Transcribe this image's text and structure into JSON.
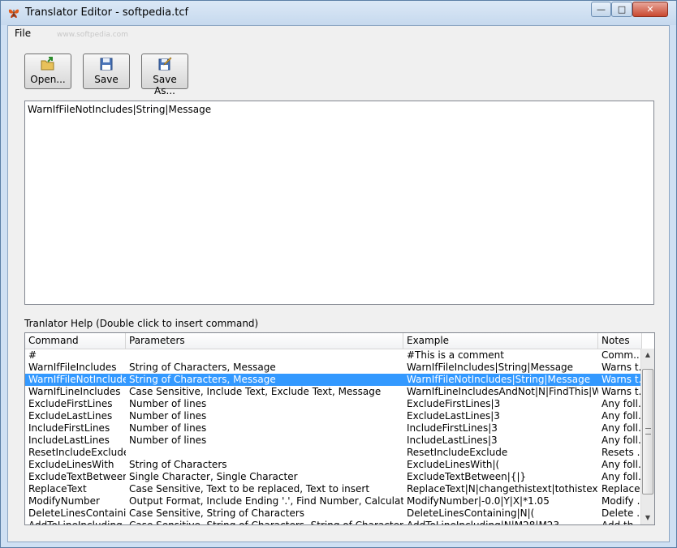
{
  "window": {
    "title": "Translator Editor - softpedia.tcf",
    "watermark": "www.softpedia.com",
    "controls": {
      "minimize": "—",
      "maximize": "□",
      "close": "✕"
    }
  },
  "menu": {
    "file": "File"
  },
  "toolbar": {
    "open_label": "Open...",
    "save_label": "Save",
    "save_as_label": "Save As..."
  },
  "editor": {
    "text": "WarnIfFileNotIncludes|String|Message"
  },
  "help": {
    "label": "Tranlator Help (Double click to insert command)",
    "columns": [
      "Command",
      "Parameters",
      "Example",
      "Notes"
    ],
    "rows": [
      [
        "#",
        "",
        "#This is a comment",
        "Comm..."
      ],
      [
        "WarnIfFileIncludes",
        "String of Characters, Message",
        "WarnIfFileIncludes|String|Message",
        "Warns t..."
      ],
      [
        "WarnIfFileNotIncludes",
        "String of Characters, Message",
        "WarnIfFileNotIncludes|String|Message",
        "Warns t..."
      ],
      [
        "WarnIfLineIncludes",
        "Case Sensitive, Include Text, Exclude Text, Message",
        "WarnIfLineIncludesAndNot|N|FindThis|Wh...",
        "Warns t..."
      ],
      [
        "ExcludeFirstLines",
        "Number of lines",
        "ExcludeFirstLines|3",
        "Any foll..."
      ],
      [
        "ExcludeLastLines",
        "Number of lines",
        "ExcludeLastLines|3",
        "Any foll..."
      ],
      [
        "IncludeFirstLines",
        "Number of lines",
        "IncludeFirstLines|3",
        "Any foll..."
      ],
      [
        "IncludeLastLines",
        "Number of lines",
        "IncludeLastLines|3",
        "Any foll..."
      ],
      [
        "ResetIncludeExclude",
        "",
        "ResetIncludeExclude",
        "Resets ..."
      ],
      [
        "ExcludeLinesWith",
        "String of Characters",
        "ExcludeLinesWith|(",
        "Any foll..."
      ],
      [
        "ExcludeTextBetween",
        "Single Character, Single Character",
        "ExcludeTextBetween|{|}",
        "Any foll..."
      ],
      [
        "ReplaceText",
        "Case Sensitive, Text to be replaced, Text to insert",
        "ReplaceText|N|changethistext|tothistext",
        "Replace..."
      ],
      [
        "ModifyNumber",
        "Output Format, Include Ending '.', Find Number, Calculation t...",
        "ModifyNumber|-0.0|Y|X|*1.05",
        "Modify ..."
      ],
      [
        "DeleteLinesContaining",
        "Case Sensitive, String of Characters",
        "DeleteLinesContaining|N|(",
        "Delete ..."
      ],
      [
        "AddToLineIncluding",
        "Case Sensitive, String of Characters, String of Characters",
        "AddToLineIncluding|N|M28|M23",
        "Add th..."
      ]
    ],
    "selected_row": 2
  },
  "icons": {
    "app": "butterfly-icon",
    "open": "open-folder-icon",
    "save": "floppy-disk-icon",
    "save_as": "save-as-icon"
  },
  "colors": {
    "selection": "#3399ff",
    "title_bg": "#c6d9ee"
  }
}
